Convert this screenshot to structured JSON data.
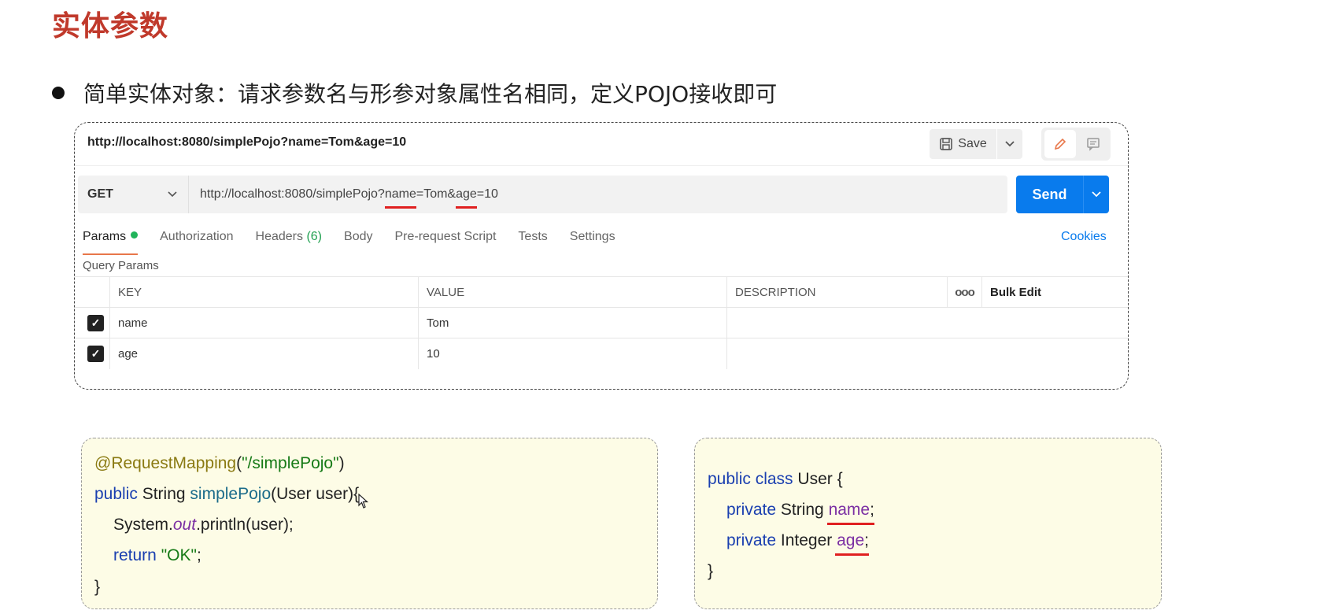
{
  "slide": {
    "title": "实体参数",
    "bullet": "简单实体对象：请求参数名与形参对象属性名相同，定义POJO接收即可"
  },
  "postman": {
    "tab_url": "http://localhost:8080/simplePojo?name=Tom&age=10",
    "save_label": "Save",
    "method": "GET",
    "url_parts": {
      "p1": "http://localhost:8080/simplePojo?",
      "p2": "name",
      "p3": "=Tom&",
      "p4": "age",
      "p5": "=10"
    },
    "send_label": "Send",
    "tabs": {
      "params": "Params",
      "authorization": "Authorization",
      "headers": "Headers",
      "headers_count": "(6)",
      "body": "Body",
      "prerequest": "Pre-request Script",
      "tests": "Tests",
      "settings": "Settings"
    },
    "cookies": "Cookies",
    "query_params_label": "Query Params",
    "table": {
      "headers": {
        "key": "KEY",
        "value": "VALUE",
        "description": "DESCRIPTION",
        "more": "ooo",
        "bulk_edit": "Bulk Edit"
      },
      "rows": [
        {
          "key": "name",
          "value": "Tom",
          "description": ""
        },
        {
          "key": "age",
          "value": "10",
          "description": ""
        }
      ]
    }
  },
  "code_controller": {
    "l1_ann": "@RequestMapping",
    "l1_paren_open": "(",
    "l1_str": "\"/simplePojo\"",
    "l1_paren_close": ")",
    "l2_public": "public",
    "l2_type": " String ",
    "l2_fn": "simplePojo",
    "l2_rest": "(User user){",
    "l3_pre": "System.",
    "l3_out": "out",
    "l3_post": ".println(user);",
    "l4_return": "return",
    "l4_str": " \"OK\"",
    "l4_semi": ";",
    "l5": "}"
  },
  "code_user": {
    "l1_kw": "public class",
    "l1_rest": " User {",
    "l2_kw": "private",
    "l2_type": " String ",
    "l2_field": "name",
    "l2_semi": ";",
    "l3_kw": "private",
    "l3_type": " Integer ",
    "l3_field": "age",
    "l3_semi": ";",
    "l4": "}"
  }
}
